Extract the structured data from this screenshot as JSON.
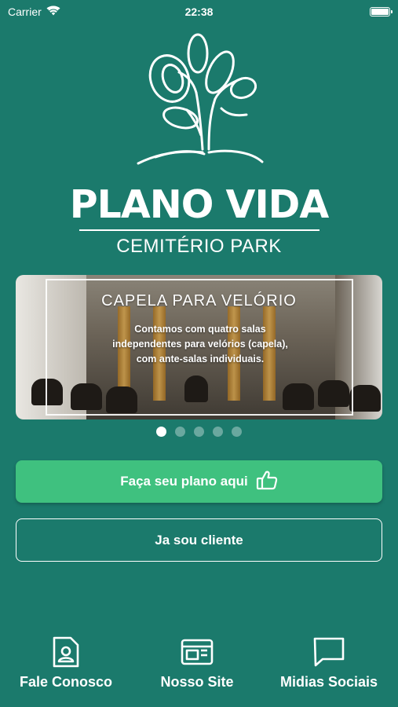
{
  "status_bar": {
    "carrier": "Carrier",
    "time": "22:38"
  },
  "brand": {
    "title": "PLANO VIDA",
    "subtitle": "CEMITÉRIO PARK"
  },
  "banner": {
    "title": "CAPELA PARA VELÓRIO",
    "text_line1": "Contamos com quatro salas",
    "text_line2": "independentes para velórios (capela),",
    "text_line3": "com ante-salas individuais."
  },
  "carousel": {
    "total": 5,
    "active_index": 0
  },
  "actions": {
    "primary_label": "Faça seu plano aqui",
    "secondary_label": "Ja sou cliente"
  },
  "nav": {
    "contact_label": "Fale Conosco",
    "site_label": "Nosso Site",
    "social_label": "Midias Sociais"
  },
  "colors": {
    "background": "#1b7a6c",
    "primary_button": "#3fc17f"
  }
}
